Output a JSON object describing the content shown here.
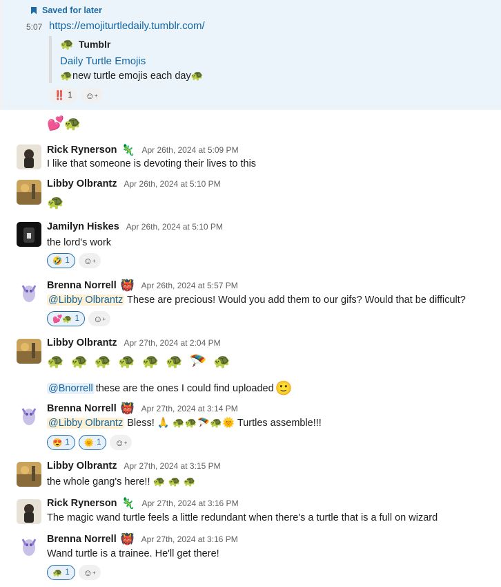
{
  "saved": {
    "label": "Saved for later",
    "time": "5:07",
    "url": "https://emojiturtledaily.tumblr.com/",
    "unfurl_source": "Tumblr",
    "unfurl_title": "Daily Turtle Emojis",
    "unfurl_desc": "🐢new turtle emojis each day🐢",
    "reaction_emoji": "‼️",
    "reaction_count": "1"
  },
  "loose_emoji": "💕🐢",
  "messages": [
    {
      "name": "Rick Rynerson",
      "status": "🦎",
      "time": "Apr 26th, 2024 at 5:09 PM",
      "text": "I like that someone is devoting their lives to this"
    },
    {
      "name": "Libby Olbrantz",
      "time": "Apr 26th, 2024 at 5:10 PM",
      "text": "🐢"
    },
    {
      "name": "Jamilyn Hiskes",
      "time": "Apr 26th, 2024 at 5:10 PM",
      "text": "the lord's work",
      "reaction_emoji": "🤣",
      "reaction_count": "1"
    },
    {
      "name": "Brenna Norrell",
      "status": "👹",
      "time": "Apr 26th, 2024 at 5:57 PM",
      "mention": "@Libby Olbrantz",
      "text": " These are precious! Would you add them  to our  gifs? Would  that be  difficult?",
      "reaction_emoji": "💕🐢",
      "reaction_count": "1"
    },
    {
      "name": "Libby Olbrantz",
      "time": "Apr 27th, 2024 at 2:04 PM",
      "emoji_row": "🐢 🐢 🐢 🐢 🐢 🐢 🪂 🐢",
      "mention": "@Bnorrell",
      "text": " these are the ones I could find uploaded",
      "text_emoji": "🙂"
    },
    {
      "name": "Brenna Norrell",
      "status": "👹",
      "time": "Apr 27th, 2024 at 3:14 PM",
      "mention": "@Libby Olbrantz",
      "text": " Bless! 🙏 🐢🐢🪂🐢🌞 Turtles assemble!!!",
      "reactions": [
        {
          "emoji": "😍",
          "count": "1"
        },
        {
          "emoji": "🌞",
          "count": "1"
        }
      ]
    },
    {
      "name": "Libby Olbrantz",
      "time": "Apr 27th, 2024 at 3:15 PM",
      "text": "the whole gang's here!! 🐢 🐢 🐢"
    },
    {
      "name": "Rick Rynerson",
      "status": "🦎",
      "time": "Apr 27th, 2024 at 3:16 PM",
      "text": "The magic wand turtle feels a little redundant when there's a turtle that is a full on wizard"
    },
    {
      "name": "Brenna Norrell",
      "status": "👹",
      "time": "Apr 27th, 2024 at 3:16 PM",
      "text": "Wand turtle is a trainee.  He'll get there!",
      "reaction_emoji": "🐢",
      "reaction_count": "1"
    }
  ],
  "icons": {
    "add_reaction": "add-reaction-icon",
    "bookmark": "bookmark-icon"
  }
}
